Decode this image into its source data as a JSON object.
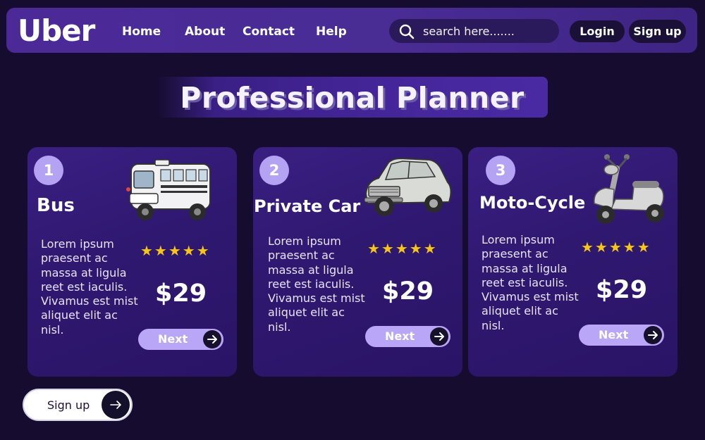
{
  "brand": {
    "logo": "Uber"
  },
  "nav": {
    "items": [
      "Home",
      "About",
      "Contact",
      "Help"
    ]
  },
  "search": {
    "placeholder": "search here......."
  },
  "auth": {
    "login_label": "Login",
    "signup_label": "Sign up"
  },
  "hero": {
    "title": "Professional Planner"
  },
  "cards": [
    {
      "number": "1",
      "title": "Bus",
      "description": "Lorem ipsum praesent ac massa at ligula reet est iaculis. Vivamus est mist aliquet elit ac nisl.",
      "stars": "★★★★★",
      "rating": 5,
      "price": "$29",
      "button_label": "Next",
      "vehicle_icon": "bus-icon"
    },
    {
      "number": "2",
      "title": "Private Car",
      "description": "Lorem ipsum praesent ac massa at ligula reet est iaculis. Vivamus est mist aliquet elit ac nisl.",
      "stars": "★★★★★",
      "rating": 5,
      "price": "$29",
      "button_label": "Next",
      "vehicle_icon": "car-icon"
    },
    {
      "number": "3",
      "title": "Moto-Cycle",
      "description": "Lorem ipsum praesent ac massa at ligula reet est iaculis. Vivamus est mist aliquet elit ac nisl.",
      "stars": "★★★★★",
      "rating": 5,
      "price": "$29",
      "button_label": "Next",
      "vehicle_icon": "scooter-icon"
    }
  ],
  "cta": {
    "label": "Sign up"
  },
  "colors": {
    "background": "#150c30",
    "navbar": "#4a2c95",
    "accent": "#b9a6f7",
    "star": "#f5c518",
    "dark_button": "#1a1038"
  }
}
